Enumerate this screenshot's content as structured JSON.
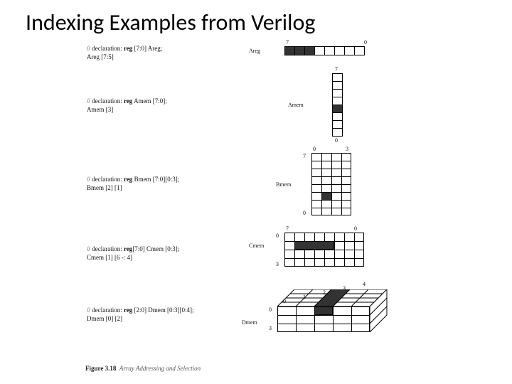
{
  "title": "Indexing Examples from Verilog",
  "examples": [
    {
      "decl_prefix": "// declaration: ",
      "decl_kw": "reg",
      "decl_rest": " [7:0] Areg;",
      "expr": "Areg [7:5]",
      "name": "Areg",
      "ticks": [
        "7",
        "0"
      ]
    },
    {
      "decl_prefix": "// declaration: ",
      "decl_kw": "reg",
      "decl_rest": " Amem [7:0];",
      "expr": "Amem [3]",
      "name": "Amem",
      "ticks": [
        "7",
        "0"
      ]
    },
    {
      "decl_prefix": "// declaration: ",
      "decl_kw": "reg",
      "decl_rest": " Bmem [7:0][0:3];",
      "expr": "Bmem [2] [1]",
      "name": "Bmem",
      "ticks": [
        "0",
        "3",
        "7",
        "0"
      ]
    },
    {
      "decl_prefix": "// declaration: ",
      "decl_kw": "reg",
      "decl_rest": "[7:0] Cmem [0:3];",
      "expr": "Cmem [1] [6 -: 4]",
      "name": "Cmem",
      "ticks": [
        "7",
        "0",
        "0",
        "3"
      ]
    },
    {
      "decl_prefix": "// declaration: ",
      "decl_kw": "reg",
      "decl_rest": " [2:0] Dmem [0:3][0:4];",
      "expr": "Dmem [0] [2]",
      "name": "Dmem",
      "ticks": [
        "0",
        "1",
        "2",
        "3",
        "4",
        "0",
        "3"
      ]
    }
  ],
  "figure": {
    "num": "Figure 3.18",
    "caption": "Array Addressing and Selection"
  }
}
